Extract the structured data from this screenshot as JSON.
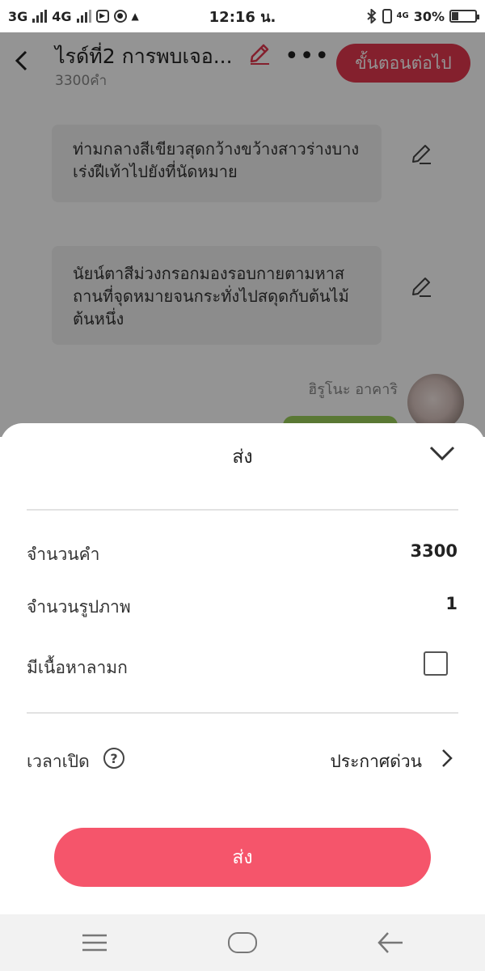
{
  "status_bar": {
    "network_1": "3G",
    "network_2": "4G",
    "time": "12:16 น.",
    "mobile_data": "4G",
    "battery_percent": "30%",
    "battery_level": 0.3
  },
  "header": {
    "title": "ไรด์ที่2 การพบเจอ...",
    "word_count": "3300คำ",
    "more_label": "•••",
    "next_button": "ขั้นตอนต่อไป"
  },
  "content": {
    "paragraphs": [
      "ท่ามกลางสีเขียวสุดกว้างขว้างสาวร่างบางเร่งฝีเท้าไปยังที่นัดหมาย",
      "นัยน์ตาสีม่วงกรอกมองรอบกายตามหาสถานที่จุดหมายจนกระทั่งไปสดุดกับต้นไม้ต้นหนึ่ง"
    ],
    "character_name": "ฮิรูโนะ อาคาริ"
  },
  "sheet": {
    "title": "ส่ง",
    "rows": {
      "word_count_label": "จำนวนคำ",
      "word_count_value": "3300",
      "image_count_label": "จำนวนรูปภาพ",
      "image_count_value": "1",
      "adult_content_label": "มีเนื้อหาลามก",
      "adult_content_checked": false,
      "publish_time_label": "เวลาเปิด",
      "publish_time_value": "ประกาศด่วน"
    },
    "help_symbol": "?",
    "send_button": "ส่ง"
  },
  "colors": {
    "accent": "#e3384f",
    "send_button": "#f5556b",
    "bubble_bg": "#f1f1f1",
    "green_bubble": "#9ccf5a"
  },
  "icons": [
    "back-arrow-icon",
    "pencil-icon",
    "more-icon",
    "chevron-down-icon",
    "question-icon",
    "chevron-right-icon",
    "menu-icon",
    "home-icon",
    "nav-back-icon",
    "bluetooth-icon",
    "battery-icon"
  ]
}
